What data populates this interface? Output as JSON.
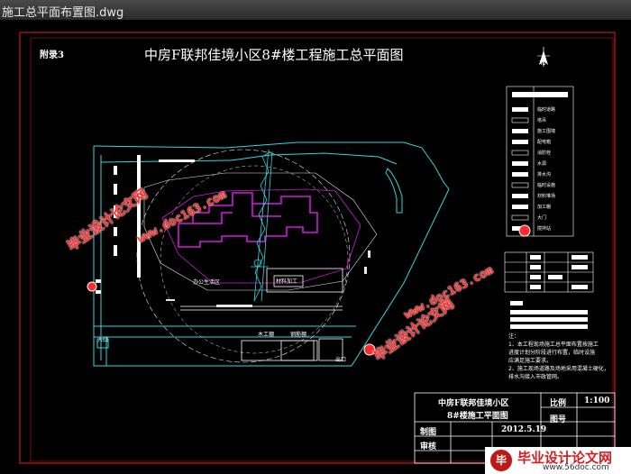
{
  "window": {
    "title": "施工总平面布置图.dwg"
  },
  "drawing": {
    "annex": "附录3",
    "title": "中房F联邦佳境小区8#楼工程施工总平面图",
    "labels": {
      "office": "办公生活区",
      "yard": "材料加工",
      "gate_in": "入口",
      "gate_out": "出口",
      "shed1": "木工棚",
      "shed2": "钢筋棚",
      "north": "北"
    },
    "title_block": {
      "project": "中房F联邦佳境小区",
      "drawing": "8#楼施工平面图",
      "scale_label": "比例",
      "scale_value": "1:100",
      "sheet_label": "图号",
      "drawn_label": "制图",
      "date": "2012.5.19",
      "check_label": "审核"
    },
    "legend_items": [
      "临时道路",
      "塔吊",
      "施工围墙",
      "配电箱",
      "消防栓",
      "水源",
      "排水沟",
      "临时设施",
      "材料堆场",
      "加工棚",
      "大门",
      "搅拌站"
    ],
    "notes": {
      "head": "注：",
      "lines": [
        "1、本工程现场施工总平面布置按施工",
        "进度计划分阶段进行布置，临时设施",
        "应满足施工要求。",
        "2、施工现场道路及场地采用混凝土硬化，",
        "排水沟接入市政管网。"
      ]
    }
  },
  "watermark": {
    "cn": "毕业设计论文网",
    "url": "www.doc163.com"
  },
  "logo": {
    "mark": "毕",
    "name": "毕业设计论文网",
    "url": "www.56doc.com"
  },
  "colors": {
    "frame_red": "#c0181c",
    "cyan": "#2fd8e0",
    "magenta": "#d21adc",
    "watermark": "#ff2a2a"
  }
}
